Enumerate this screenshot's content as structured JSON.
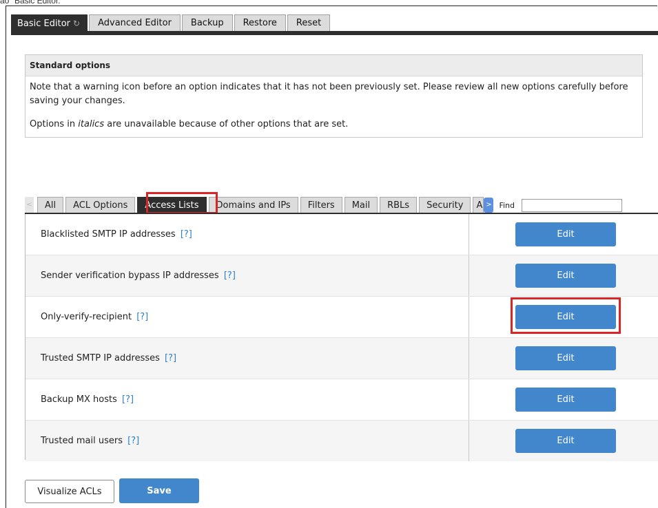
{
  "caption": "ao \"Basic Editor.\"",
  "top_tabs": [
    {
      "label": "Basic Editor",
      "active": true
    },
    {
      "label": "Advanced Editor",
      "active": false
    },
    {
      "label": "Backup",
      "active": false
    },
    {
      "label": "Restore",
      "active": false
    },
    {
      "label": "Reset",
      "active": false
    }
  ],
  "standard_options": {
    "heading": "Standard options",
    "note": "Note that a warning icon before an option indicates that it has not been previously set. Please review all new options carefully before saving your changes.",
    "italics_prefix": "Options in ",
    "italics_word": "italics",
    "italics_suffix": " are unavailable because of other options that are set."
  },
  "sub_tabs": [
    {
      "label": "All",
      "active": false
    },
    {
      "label": "ACL Options",
      "active": false
    },
    {
      "label": "Access Lists",
      "active": true
    },
    {
      "label": "Domains and IPs",
      "active": false
    },
    {
      "label": "Filters",
      "active": false
    },
    {
      "label": "Mail",
      "active": false
    },
    {
      "label": "RBLs",
      "active": false
    },
    {
      "label": "Security",
      "active": false
    },
    {
      "label": "A",
      "active": false
    }
  ],
  "scroll_left_glyph": "<",
  "scroll_right_glyph": ">",
  "find": {
    "label": "Find",
    "value": ""
  },
  "help_text": "[?]",
  "acl_rows": [
    {
      "label": "Blacklisted SMTP IP addresses",
      "button": "Edit"
    },
    {
      "label": "Sender verification bypass IP addresses",
      "button": "Edit"
    },
    {
      "label": "Only-verify-recipient",
      "button": "Edit"
    },
    {
      "label": "Trusted SMTP IP addresses",
      "button": "Edit"
    },
    {
      "label": "Backup MX hosts",
      "button": "Edit"
    },
    {
      "label": "Trusted mail users",
      "button": "Edit"
    }
  ],
  "actions": {
    "visualize": "Visualize ACLs",
    "save": "Save"
  },
  "colors": {
    "accent": "#4287cc",
    "highlight": "#d92525",
    "tab_active": "#2e2e2e"
  }
}
